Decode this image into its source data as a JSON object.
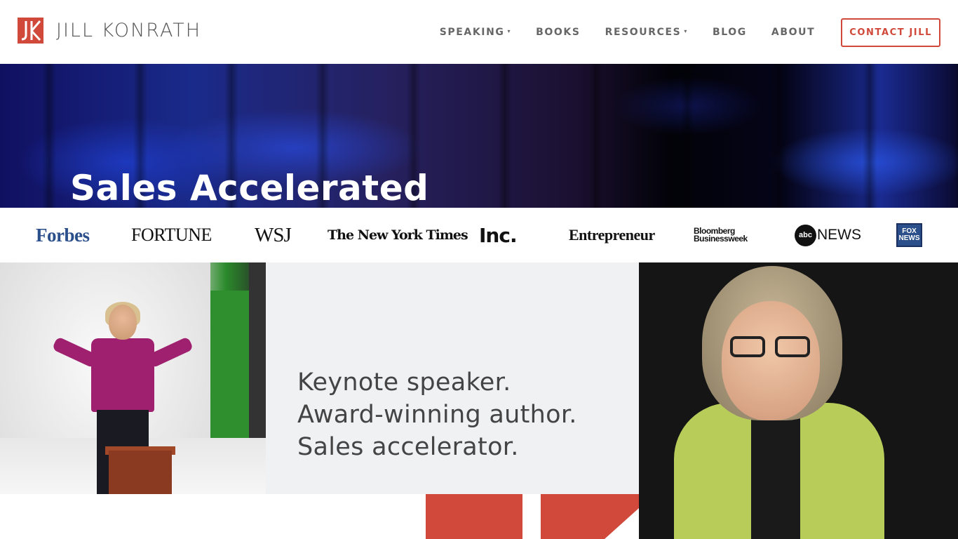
{
  "brand": {
    "name": "JILL KONRATH",
    "mark": "JK",
    "accent_color": "#d0493a"
  },
  "nav": {
    "items": [
      {
        "label": "SPEAKING",
        "has_dropdown": true
      },
      {
        "label": "BOOKS",
        "has_dropdown": false
      },
      {
        "label": "RESOURCES",
        "has_dropdown": true
      },
      {
        "label": "BLOG",
        "has_dropdown": false
      },
      {
        "label": "ABOUT",
        "has_dropdown": false
      }
    ],
    "cta_label": "CONTACT JILL",
    "caret": "▾"
  },
  "hero": {
    "title": "Sales Accelerated"
  },
  "media_logos": {
    "forbes": "Forbes",
    "fortune": "FORTUNE",
    "wsj": "WSJ",
    "nyt": "The New York Times",
    "inc": "Inc.",
    "entrepreneur": "Entrepreneur",
    "bloomberg_line1": "Bloomberg",
    "bloomberg_line2": "Businessweek",
    "abc_circle": "abc",
    "abc_news": "NEWS",
    "fox_line1": "FOX",
    "fox_line2": "NEWS"
  },
  "tagline": {
    "lines": [
      "Keynote speaker.",
      "Award-winning author.",
      "Sales accelerator."
    ]
  }
}
